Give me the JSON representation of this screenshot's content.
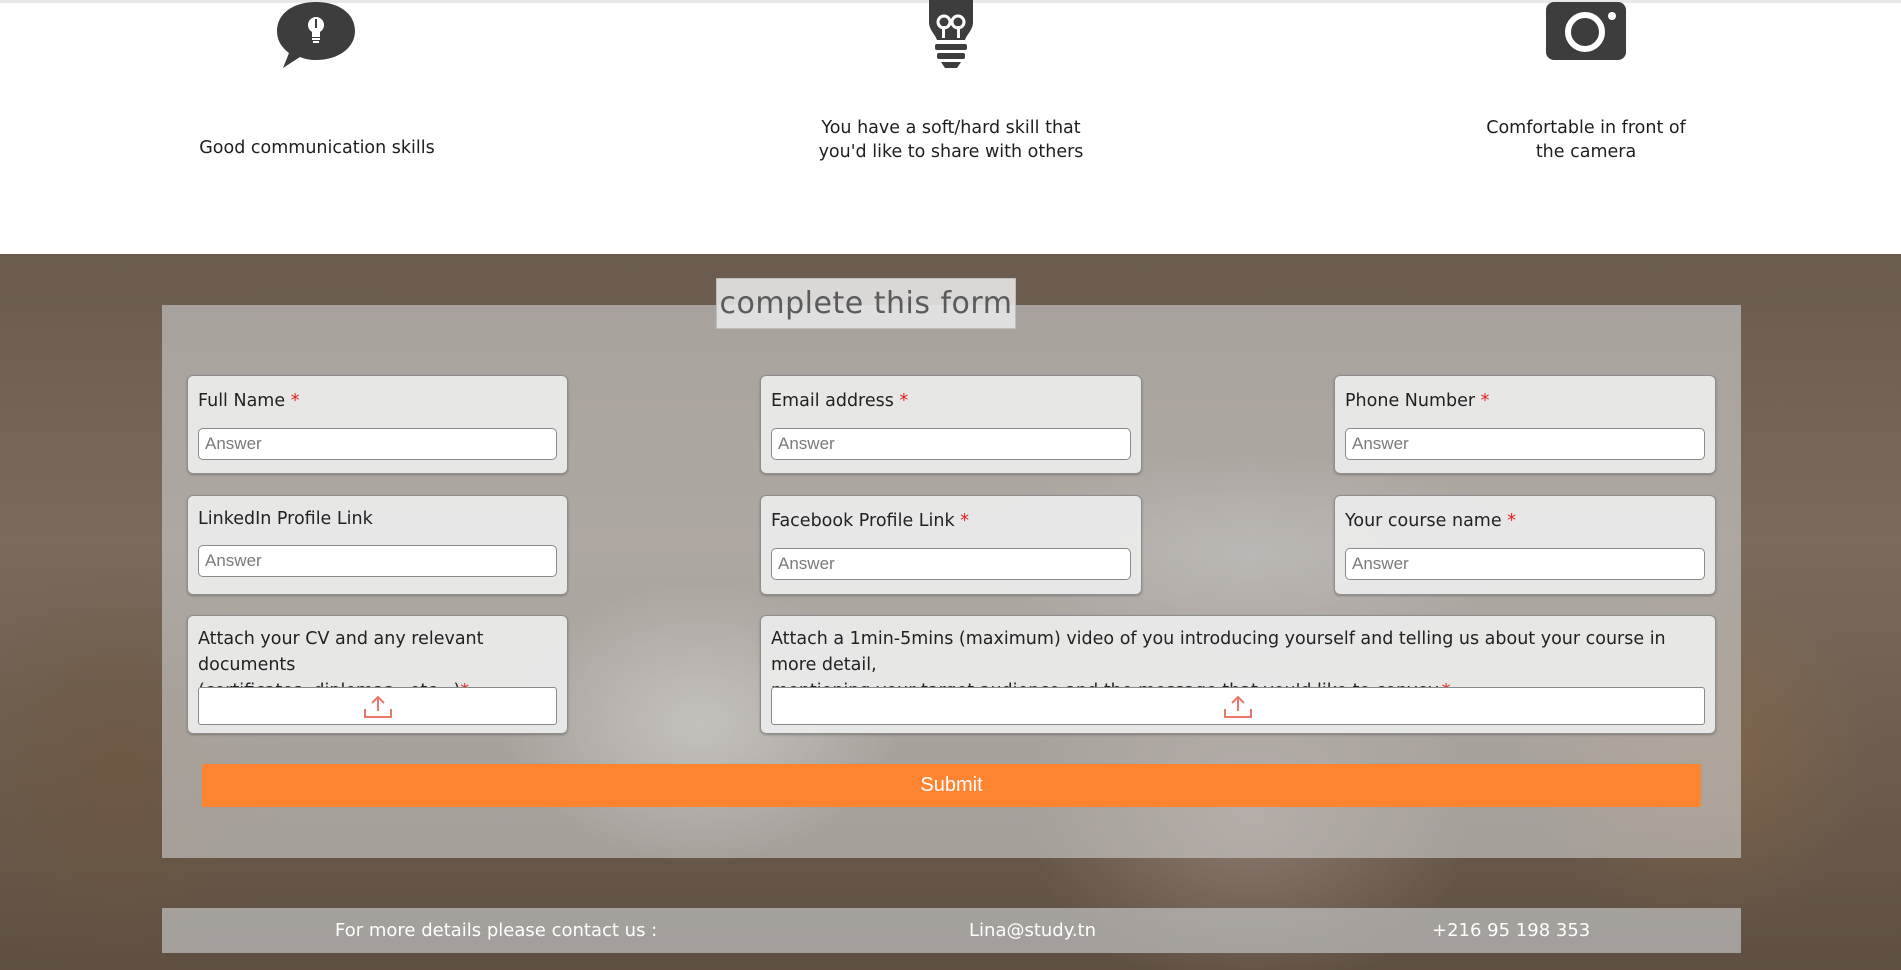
{
  "features": [
    {
      "icon": "speech-bubble-lightbulb-icon",
      "text": "Good communication skills"
    },
    {
      "icon": "lightbulb-icon",
      "text_line1": "You have a soft/hard skill that",
      "text_line2": "you'd like to share with others"
    },
    {
      "icon": "camera-icon",
      "text_line1": "Comfortable in front of",
      "text_line2": "the camera"
    }
  ],
  "form": {
    "title": "complete this form",
    "required_mark": "*",
    "answer_placeholder": "Answer",
    "fields": {
      "full_name": {
        "label": "Full Name",
        "value": ""
      },
      "email": {
        "label": "Email address",
        "value": ""
      },
      "phone": {
        "label": "Phone Number",
        "value": ""
      },
      "linkedin": {
        "label": "LinkedIn Profile Link",
        "value": ""
      },
      "facebook": {
        "label": "Facebook Profile Link",
        "value": ""
      },
      "course": {
        "label": "Your course name",
        "value": ""
      },
      "cv": {
        "label_line1": "Attach your CV and any relevant documents",
        "label_line2": "(certificates, diplomas...etc...)"
      },
      "video": {
        "label_line1": "Attach a 1min-5mins (maximum) video of you introducing yourself and telling us about your course in more detail,",
        "label_line2": "mentioning your target audience and the message that you'd like to convey."
      }
    },
    "submit_label": "Submit",
    "upload_icon": "upload-icon"
  },
  "contact": {
    "prompt": "For more details please contact us :",
    "email": "Lina@study.tn",
    "phone": "+216 95 198 353"
  },
  "colors": {
    "accent": "#ff8431",
    "required": "#e0201e",
    "icon": "#3d3d3d"
  }
}
